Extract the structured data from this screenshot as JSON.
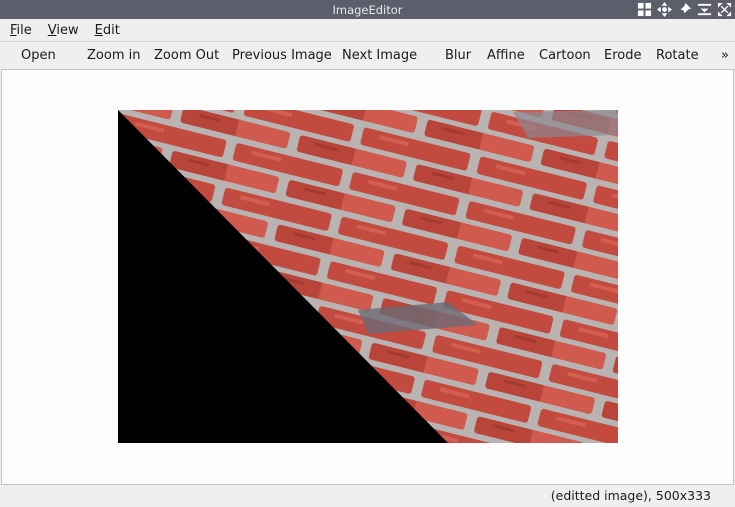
{
  "window": {
    "title": "ImageEditor",
    "controls": [
      "grid-icon",
      "move-icon",
      "pin-icon",
      "minimize-icon",
      "close-icon"
    ]
  },
  "menu": {
    "file": {
      "mnemonic": "F",
      "rest": "ile"
    },
    "view": {
      "mnemonic": "V",
      "rest": "iew"
    },
    "edit": {
      "mnemonic": "E",
      "rest": "dit"
    }
  },
  "toolbar": {
    "open": "Open",
    "zoom_in": "Zoom in",
    "zoom_out": "Zoom Out",
    "previous": "Previous Image",
    "next": "Next Image",
    "blur": "Blur",
    "affine": "Affine",
    "cartoon": "Cartoon",
    "erode": "Erode",
    "rotate": "Rotate",
    "overflow": "»"
  },
  "status": {
    "text": "(editted image), 500x333"
  },
  "colors": {
    "brick": "#c24a3f",
    "mortar": "#b9b4b2",
    "shadow": "#000000"
  }
}
